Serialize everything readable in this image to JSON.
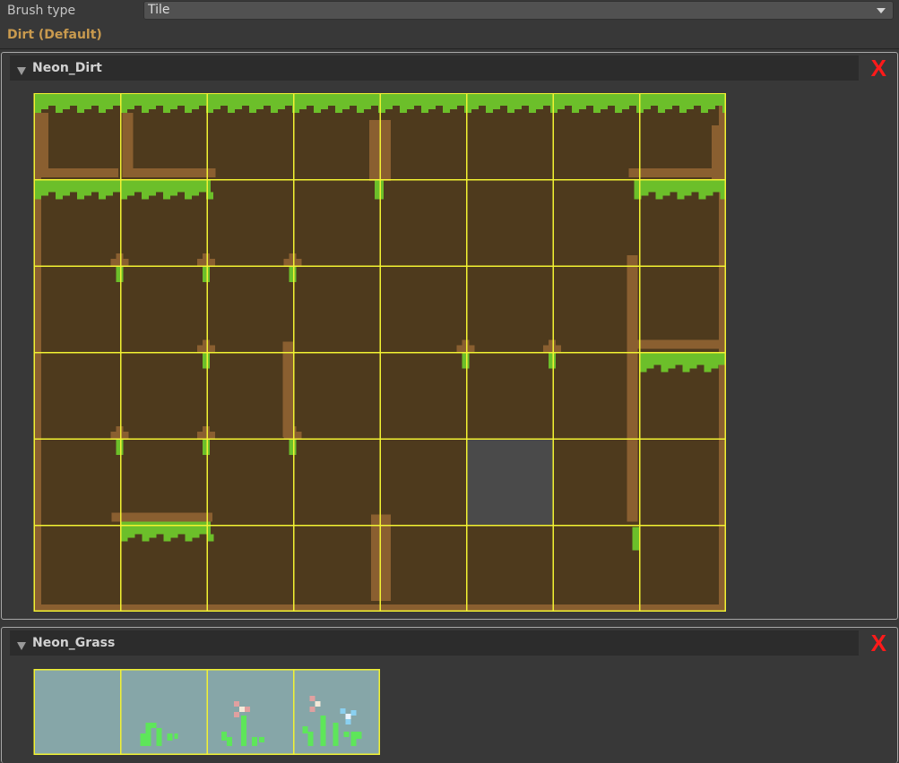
{
  "brush": {
    "label": "Brush type",
    "selected": "Tile",
    "active_brush": "Dirt (Default)"
  },
  "palettes": [
    {
      "name": "Neon_Dirt",
      "remove_label": "X",
      "columns": 8,
      "rows": 6,
      "empty_cell": {
        "row": 4,
        "col": 5
      }
    },
    {
      "name": "Neon_Grass",
      "remove_label": "X",
      "columns": 4,
      "rows": 1
    }
  ],
  "icons": {
    "dropdown": "triangle-down-icon",
    "foldout": "foldout-triangle-icon",
    "remove": "remove-x-icon"
  },
  "colors": {
    "background": "#383838",
    "header_bg": "#2c2c2c",
    "label_orange": "#c99a4e",
    "remove_red": "#ff1a1a",
    "grid_yellow": "#f2f232",
    "dirt": "#4e3a1d",
    "dirt_edge": "#8a5f30",
    "grass": "#6cbf2a",
    "grass_tile_bg": "#86a6a8",
    "sprout": "#5ee65a"
  }
}
